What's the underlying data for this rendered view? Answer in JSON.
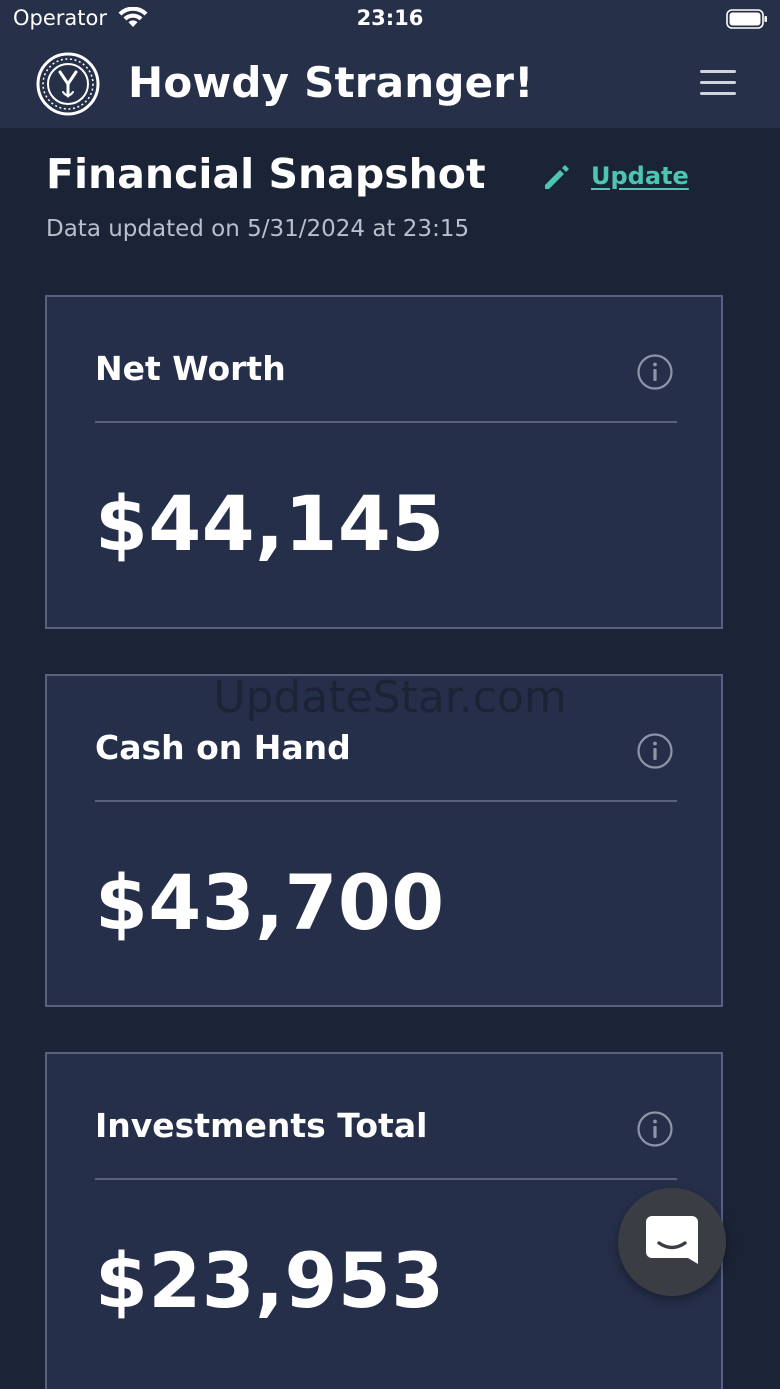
{
  "status_bar": {
    "carrier": "Operator",
    "time": "23:16"
  },
  "header": {
    "title": "Howdy Stranger!"
  },
  "snapshot": {
    "title": "Financial Snapshot",
    "update_label": "Update",
    "updated_text": "Data updated on 5/31/2024 at 23:15"
  },
  "cards": [
    {
      "title": "Net Worth",
      "value": "$44,145"
    },
    {
      "title": "Cash on Hand",
      "value": "$43,700"
    },
    {
      "title": "Investments Total",
      "value": "$23,953"
    }
  ],
  "watermark": "UpdateStar.com",
  "colors": {
    "background": "#1b2336",
    "header": "#273049",
    "card": "#262f4a",
    "card_border": "#59617f",
    "accent": "#4dc5b0"
  }
}
